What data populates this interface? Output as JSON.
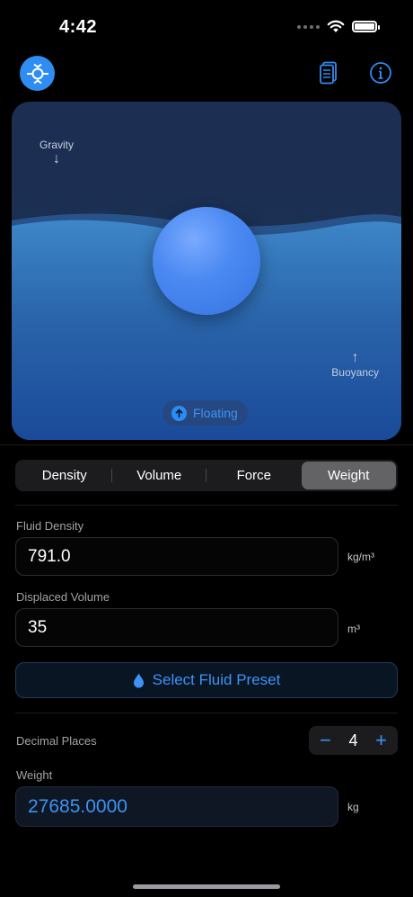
{
  "status_bar": {
    "time": "4:42"
  },
  "simulation": {
    "gravity_label": "Gravity",
    "buoyancy_label": "Buoyancy",
    "down_arrow": "↓",
    "up_arrow": "↑",
    "state_label": "Floating"
  },
  "tabs": [
    {
      "label": "Density",
      "active": false
    },
    {
      "label": "Volume",
      "active": false
    },
    {
      "label": "Force",
      "active": false
    },
    {
      "label": "Weight",
      "active": true
    }
  ],
  "fluid_density": {
    "label": "Fluid Density",
    "value": "791.0",
    "unit": "kg/m³"
  },
  "displaced_volume": {
    "label": "Displaced Volume",
    "value": "35",
    "unit": "m³"
  },
  "preset_button": {
    "label": "Select Fluid Preset"
  },
  "decimal_places": {
    "label": "Decimal Places",
    "value": "4",
    "minus": "−",
    "plus": "+"
  },
  "result": {
    "label": "Weight",
    "value": "27685.0000",
    "unit": "kg"
  },
  "colors": {
    "accent": "#3b93f5",
    "background": "#000000",
    "water": "#2f6fb3",
    "ball": "#4c8af2"
  },
  "icons": [
    "wifi-icon",
    "battery-icon",
    "app-logo-icon",
    "document-icon",
    "info-icon",
    "arrow-up-circle-icon",
    "water-drop-icon"
  ]
}
